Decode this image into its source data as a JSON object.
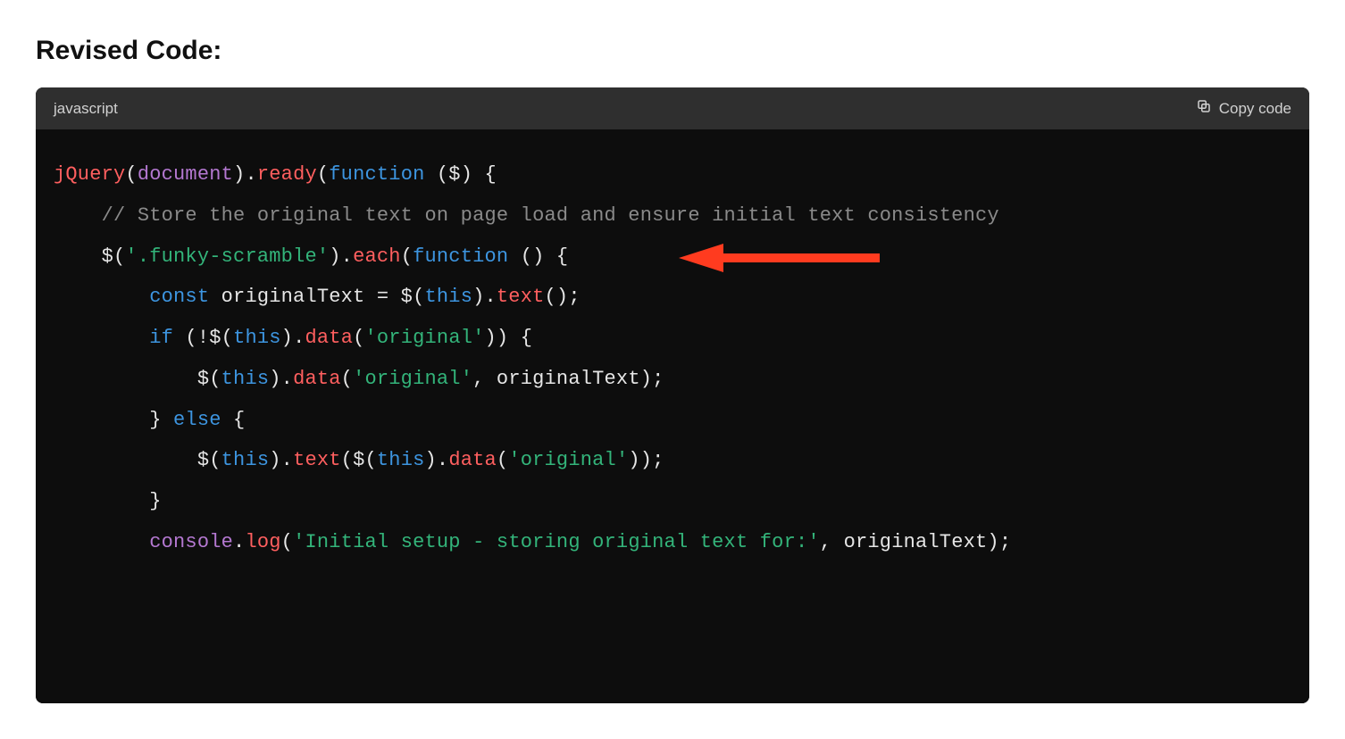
{
  "heading": "Revised Code:",
  "header": {
    "language": "javascript",
    "copy_label": "Copy code"
  },
  "code": {
    "l1": {
      "jquery": "jQuery",
      "lp": "(",
      "document": "document",
      "rp": ").",
      "ready": "ready",
      "lp2": "(",
      "function": "function",
      "args": " ($) {"
    },
    "l2": {
      "indent": "    ",
      "comment": "// Store the original text on page load and ensure initial text consistency"
    },
    "l3": {
      "indent": "    ",
      "dollar": "$(",
      "sel": "'.funky-scramble'",
      "rp": ").",
      "each": "each",
      "lp2": "(",
      "function": "function",
      "args": " () {"
    },
    "l4": {
      "indent": "        ",
      "const": "const",
      "sp": " originalText = ",
      "dollar": "$(",
      "this": "this",
      "rp": ").",
      "text": "text",
      "end": "();"
    },
    "l5": {
      "indent": "        ",
      "if": "if",
      "sp": " (!",
      "dollar": "$(",
      "this": "this",
      "rp": ").",
      "data": "data",
      "lp2": "(",
      "str": "'original'",
      "end": ")) {"
    },
    "l6": {
      "indent": "            ",
      "dollar": "$(",
      "this": "this",
      "rp": ").",
      "data": "data",
      "lp2": "(",
      "str": "'original'",
      "comma": ", originalText);"
    },
    "l7": {
      "indent": "        ",
      "brace": "} ",
      "else": "else",
      "end": " {"
    },
    "l8": {
      "indent": "            ",
      "dollar": "$(",
      "this": "this",
      "rp": ").",
      "text": "text",
      "lp2": "(",
      "dollar2": "$(",
      "this2": "this",
      "rp2": ").",
      "data": "data",
      "lp3": "(",
      "str": "'original'",
      "end": "));"
    },
    "l9": {
      "indent": "        ",
      "brace": "}"
    },
    "l10": {
      "indent": "        ",
      "console": "console",
      "dot": ".",
      "log": "log",
      "lp": "(",
      "str": "'Initial setup - storing original text for:'",
      "comma": ", originalText);"
    }
  }
}
